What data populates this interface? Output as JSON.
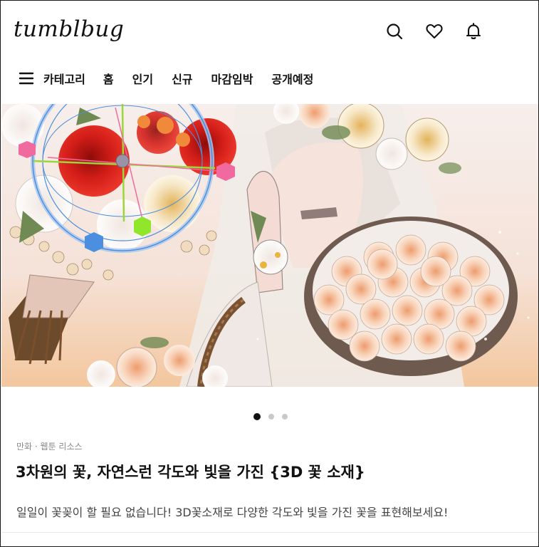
{
  "header": {
    "logo": "tumblbug",
    "icons": [
      "search-icon",
      "heart-icon",
      "bell-icon"
    ]
  },
  "nav": {
    "menu_icon": "hamburger-menu-icon",
    "items": [
      "카테고리",
      "홈",
      "인기",
      "신규",
      "마감임박",
      "공개예정"
    ]
  },
  "banner": {
    "description": "3D flower bouquet illustration",
    "carousel_dots": 3,
    "active_dot": 0
  },
  "project": {
    "category": "만화 · 웹툰 리소스",
    "title": "3차원의 꽃, 자연스런 각도와 빛을 가진 {3D 꽃 소재}",
    "description": "일일이 꽃꽂이 할 필요 없습니다! 3D꽃소재로 다양한 각도와 빛을 가진 꽃을 표현해보세요!"
  },
  "colors": {
    "text": "#111111",
    "muted": "#8a8a8a",
    "rose_red": "#d6201c",
    "peach": "#f4b890",
    "gizmo_blue": "#4c8fe0"
  }
}
